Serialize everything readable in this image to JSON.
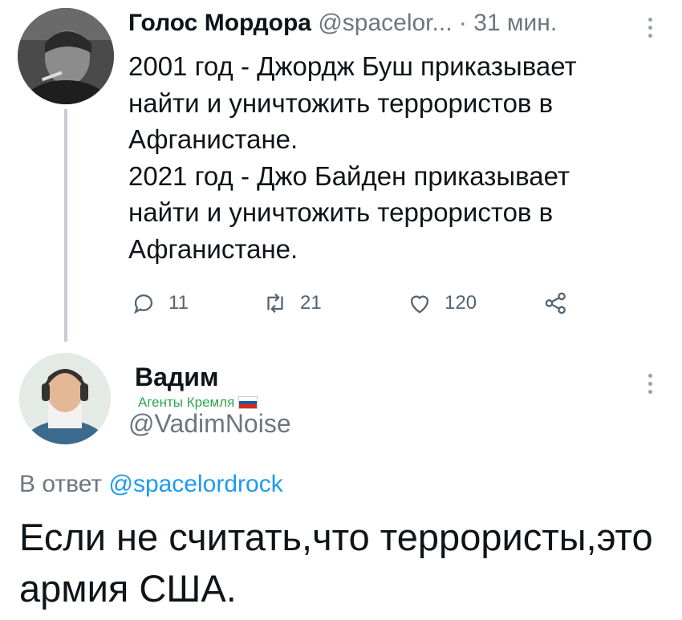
{
  "tweet1": {
    "author_name": "Голос Мордора",
    "author_handle": "@spacelor...",
    "time": "· 31 мин.",
    "body": "2001 год - Джордж Буш приказывает\nнайти и уничтожить террористов в\nАфганистане.\n2021 год - Джо Байден приказывает\nнайти и уничтожить террористов в\nАфганистане.",
    "replies": "11",
    "retweets": "21",
    "likes": "120"
  },
  "tweet2": {
    "author_name": "Вадим",
    "author_label": "Агенты Кремля",
    "author_handle": "@VadimNoise",
    "reply_prefix": "В ответ",
    "reply_handle": "@spacelordrock",
    "body": "Если не считать,что террористы,это армия США."
  },
  "colors": {
    "link": "#1d9bf0",
    "muted": "#6e767d",
    "label": "#2ea44f",
    "thread_line": "#c8ccd1"
  },
  "icons": [
    "reply-icon",
    "retweet-icon",
    "like-icon",
    "share-icon",
    "more-icon"
  ]
}
